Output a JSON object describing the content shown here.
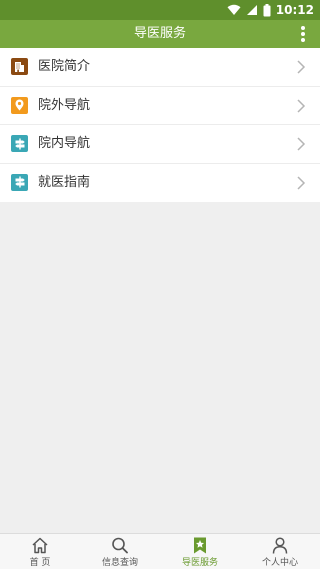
{
  "status_bar": {
    "time": "10:12"
  },
  "app_bar": {
    "title": "导医服务"
  },
  "menu": {
    "items": [
      {
        "label": "医院简介",
        "icon": "hospital-building-icon",
        "color": "#8b4a12"
      },
      {
        "label": "院外导航",
        "icon": "location-pin-icon",
        "color": "#f29a1d"
      },
      {
        "label": "院内导航",
        "icon": "signpost-icon",
        "color": "#3aa7b5"
      },
      {
        "label": "就医指南",
        "icon": "signpost-icon",
        "color": "#3aa7b5"
      }
    ]
  },
  "tab_bar": {
    "tabs": [
      {
        "label": "首 页",
        "icon": "home-icon",
        "active": false
      },
      {
        "label": "信息查询",
        "icon": "search-icon",
        "active": false
      },
      {
        "label": "导医服务",
        "icon": "bookmark-star-icon",
        "active": true
      },
      {
        "label": "个人中心",
        "icon": "person-icon",
        "active": false
      }
    ]
  },
  "colors": {
    "status_bar": "#5f8f2c",
    "app_bar": "#79a83f",
    "active_tab": "#6a9a2f",
    "background": "#efefef"
  }
}
